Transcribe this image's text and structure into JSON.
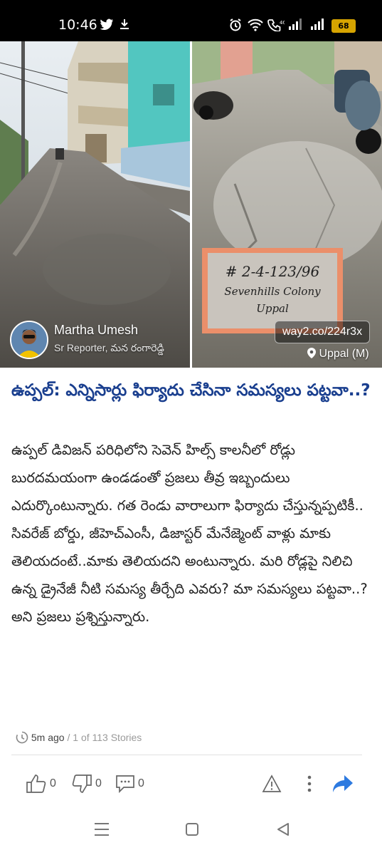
{
  "status_bar": {
    "time": "10:46",
    "battery": "68"
  },
  "article": {
    "author": {
      "name": "Martha Umesh",
      "role": "Sr Reporter, మన రంగారెడ్డి"
    },
    "short_link": "way2.co/224r3x",
    "location": "Uppal (M)",
    "plaque": {
      "number": "# 2-4-123/96",
      "line1": "Sevenhills Colony",
      "line2": "Uppal"
    },
    "headline": "ఉప్పల్: ఎన్నిసార్లు ఫిర్యాదు చేసినా సమస్యలు పట్టవా..?",
    "body": "ఉప్పల్ డివిజన్ పరిధిలోని సెవెన్ హిల్స్ కాలనీలో రోడ్లు బురదమయంగా ఉండడంతో ప్రజలు తీవ్ర ఇబ్బందులు ఎదుర్కొంటున్నారు. గత రెండు వారాలుగా ఫిర్యాదు చేస్తున్నప్పటికీ.. సివరేజ్ బోర్డు, జీహెచ్ఎంసీ, డిజాస్టర్ మేనేజ్మెంట్ వాళ్లు మాకు తెలియదంటే..మాకు తెలియదని అంటున్నారు. మరి రోడ్లపై నిలిచి ఉన్న డ్రైనేజీ నీటి సమస్య తీర్చేది ఎవరు? మా సమస్యలు పట్టవా..? అని ప్రజలు ప్రశ్నిస్తున్నారు.",
    "time_ago": "5m ago",
    "separator": "/",
    "story_position": "1 of 113 Stories"
  },
  "actions": {
    "likes": "0",
    "dislikes": "0",
    "comments": "0"
  },
  "colors": {
    "headline": "#1a3f8f",
    "share": "#2d7ae0",
    "battery": "#d6a400"
  },
  "icons": [
    "wifi-icon",
    "call-icon",
    "signal-icon",
    "like-icon",
    "dislike-icon",
    "comment-icon",
    "report-icon",
    "more-icon",
    "share-icon",
    "recent-apps-icon",
    "home-icon",
    "back-icon"
  ]
}
